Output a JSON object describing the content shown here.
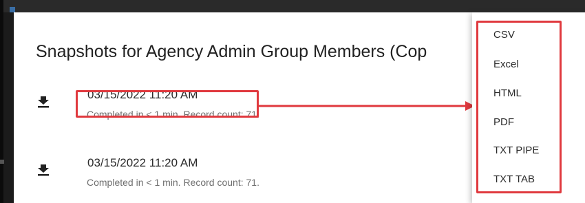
{
  "dialog": {
    "title": "Snapshots for Agency Admin Group Members (Cop"
  },
  "snapshots": [
    {
      "date": "03/15/2022 11:20 AM",
      "status": "Completed in < 1 min. Record count: 71.",
      "icon": "download-icon"
    },
    {
      "date": "03/15/2022 11:20 AM",
      "status": "Completed in < 1 min. Record count: 71.",
      "icon": "download-icon"
    }
  ],
  "export_menu": {
    "items": [
      {
        "label": "CSV"
      },
      {
        "label": "Excel"
      },
      {
        "label": "HTML"
      },
      {
        "label": "PDF"
      },
      {
        "label": "TXT PIPE"
      },
      {
        "label": "TXT TAB"
      }
    ]
  },
  "colors": {
    "annotation_red": "#e0393e",
    "dialog_background": "#ffffff",
    "backdrop": "#1b1b1b",
    "text_primary": "#2b2b2b",
    "text_secondary": "#6f6f6f"
  }
}
